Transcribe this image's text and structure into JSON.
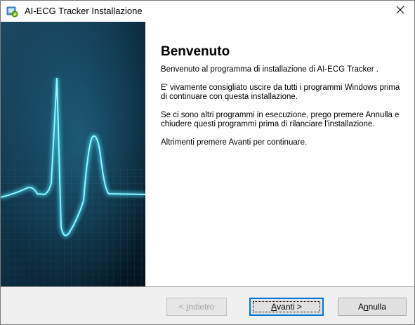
{
  "window": {
    "title": "AI-ECG Tracker Installazione",
    "close_glyph": "✕"
  },
  "welcome": {
    "heading": "Benvenuto",
    "paragraphs": [
      "Benvenuto al programma di installazione di AI-ECG Tracker .",
      "E' vivamente consigliato uscire da tutti i programmi Windows prima di continuare con questa installazione.",
      "Se ci sono altri programmi in esecuzione, prego premere Annulla e chiudere questi programmi prima di rilanciare l'installazione.",
      "Altrimenti premere Avanti per continuare."
    ]
  },
  "buttons": {
    "back": {
      "prefix": "< ",
      "mnemonic": "I",
      "rest": "ndietro",
      "enabled": false
    },
    "next": {
      "mnemonic": "A",
      "rest": "vanti >",
      "enabled": true,
      "focused": true
    },
    "cancel": {
      "prefix": "A",
      "mnemonic": "n",
      "rest": "nulla",
      "enabled": true
    }
  },
  "icons": {
    "app": "installer-icon",
    "close": "close-icon",
    "side": "ecg-waveform-banner"
  },
  "colors": {
    "banner_bg": "#0b2a3e",
    "waveform": "#5ff0ff",
    "focus_border": "#0078d7",
    "footer_bg": "#f0f0f0"
  }
}
